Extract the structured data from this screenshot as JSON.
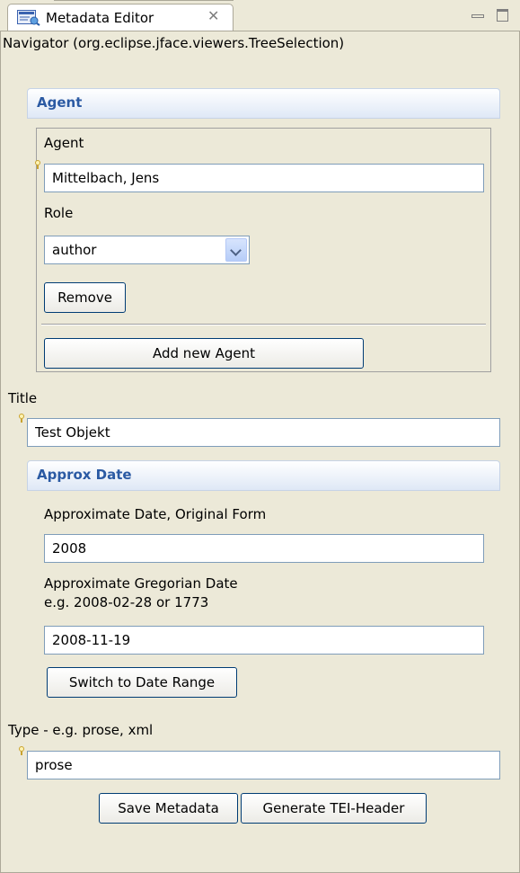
{
  "tab": {
    "title": "Metadata Editor",
    "close": "✕"
  },
  "navigator": "Navigator (org.eclipse.jface.viewers.TreeSelection)",
  "agent_section": {
    "header": "Agent",
    "agent_label": "Agent",
    "agent_value": "Mittelbach, Jens",
    "role_label": "Role",
    "role_value": "author",
    "remove_button": "Remove",
    "add_button": "Add new Agent"
  },
  "title_field": {
    "label": "Title",
    "value": "Test Objekt"
  },
  "approx_date_section": {
    "header": "Approx Date",
    "original_label": "Approximate Date, Original Form",
    "original_value": "2008",
    "gregorian_label_line1": "Approximate Gregorian Date",
    "gregorian_label_line2": "e.g. 2008-02-28 or 1773",
    "gregorian_value": "2008-11-19",
    "switch_button": "Switch to Date Range"
  },
  "type_field": {
    "label": "Type - e.g. prose, xml",
    "value": "prose"
  },
  "buttons": {
    "save": "Save Metadata",
    "generate": "Generate TEI-Header"
  },
  "colors": {
    "section_header_text": "#2b5aa3",
    "background": "#ece9d8",
    "button_border": "#003c74"
  }
}
